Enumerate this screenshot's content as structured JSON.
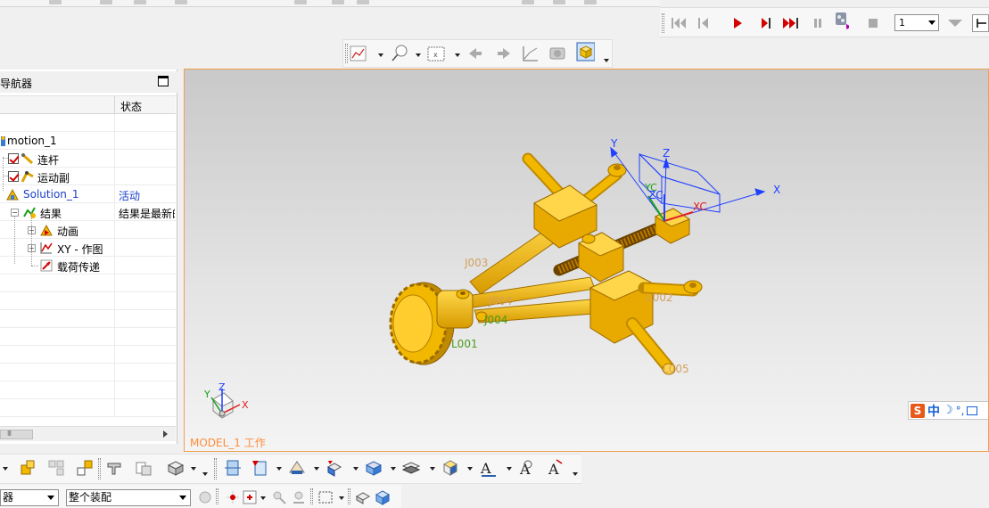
{
  "navigator": {
    "title": "导航器",
    "column_status": "状态",
    "rows": [
      {
        "label": "motion_1",
        "status": ""
      },
      {
        "label": "连杆",
        "status": ""
      },
      {
        "label": "运动副",
        "status": ""
      },
      {
        "label": "Solution_1",
        "status": "活动"
      },
      {
        "label": "结果",
        "status": "结果是最新的"
      },
      {
        "label": "动画",
        "status": ""
      },
      {
        "label": "XY - 作图",
        "status": ""
      },
      {
        "label": "载荷传递",
        "status": ""
      }
    ],
    "scrollbar_grip": "III"
  },
  "animation": {
    "frame_value": "1"
  },
  "viewport": {
    "label": "MODEL_1 工作",
    "axes": {
      "x": "X",
      "y": "Y",
      "z": "Z",
      "xc": "XC",
      "yc": "YC",
      "zc": "ZC"
    },
    "triad": {
      "x": "X",
      "y": "Y",
      "z": "Z"
    },
    "part_labels": [
      "J003",
      "J004",
      "J004",
      "L001",
      "L002",
      "L005"
    ],
    "ime": {
      "s": "S",
      "mode": "中",
      "moon": "☽",
      "punct": "°,"
    }
  },
  "bottom": {
    "filter_combo": "器",
    "assembly_combo": "整个装配"
  },
  "colors": {
    "part": "#f2b800",
    "part_dark": "#c08a00",
    "csys": "#2040ff",
    "accent": "#ff8c3a",
    "play_red": "#d40000"
  }
}
